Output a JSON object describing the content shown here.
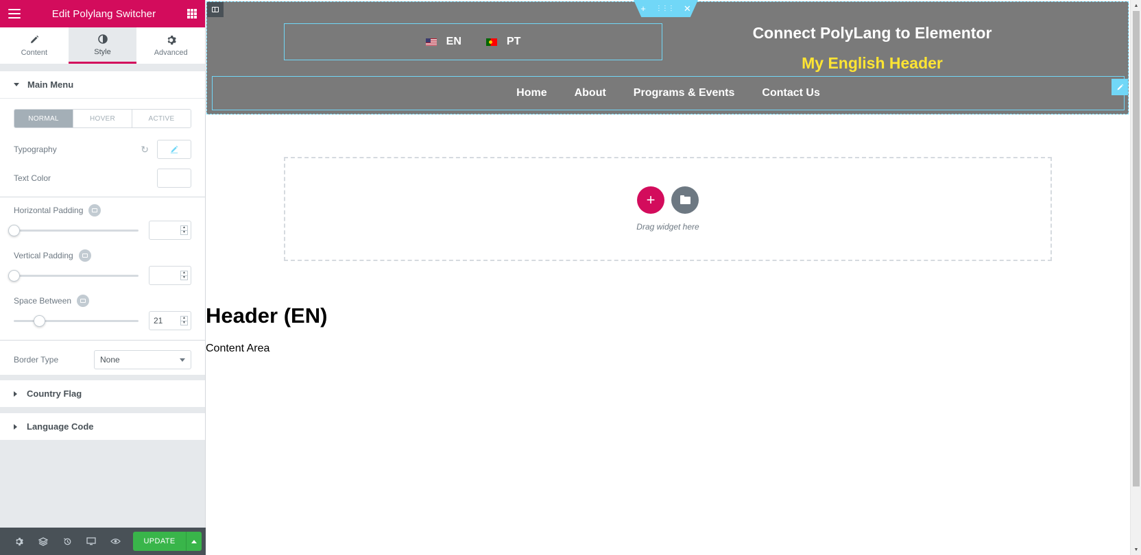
{
  "panel": {
    "title": "Edit Polylang Switcher",
    "tabs": [
      {
        "label": "Content",
        "icon": "pencil-icon"
      },
      {
        "label": "Style",
        "icon": "contrast-icon"
      },
      {
        "label": "Advanced",
        "icon": "gear-icon"
      }
    ],
    "active_tab": "Style",
    "main_menu": {
      "title": "Main Menu",
      "states": [
        "NORMAL",
        "HOVER",
        "ACTIVE"
      ],
      "active_state": "NORMAL",
      "typography_label": "Typography",
      "text_color_label": "Text Color",
      "horizontal_padding_label": "Horizontal Padding",
      "horizontal_padding_value": "",
      "vertical_padding_label": "Vertical Padding",
      "vertical_padding_value": "",
      "space_between_label": "Space Between",
      "space_between_value": "21",
      "border_type_label": "Border Type",
      "border_type_value": "None"
    },
    "country_flag_title": "Country Flag",
    "language_code_title": "Language Code",
    "footer": {
      "update_label": "UPDATE"
    },
    "accent_color": "#d30c5c"
  },
  "preview": {
    "languages": [
      {
        "code": "EN",
        "flag": "us-flag-icon"
      },
      {
        "code": "PT",
        "flag": "portugal-flag-icon"
      }
    ],
    "site_title": "Connect PolyLang to Elementor",
    "site_subtitle": "My English Header",
    "nav": [
      "Home",
      "About",
      "Programs & Events",
      "Contact Us"
    ],
    "drop_text": "Drag widget here",
    "page_heading": "Header (EN)",
    "content_text": "Content Area",
    "header_bg": "#7a7a7a",
    "subtitle_color": "#ffe533"
  }
}
